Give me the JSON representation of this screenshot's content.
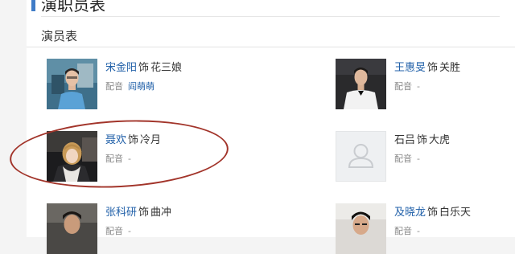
{
  "section": {
    "title": "演职员表"
  },
  "sub": {
    "title": "演员表"
  },
  "cast": [
    {
      "actor": "宋金阳",
      "shi": "饰",
      "role": "花三娘",
      "voice_label": "配音",
      "voice": "阎萌萌"
    },
    {
      "actor": "王惠旻",
      "shi": "饰",
      "role": "关胜",
      "voice_label": "配音",
      "voice": "-"
    },
    {
      "actor": "聂欢",
      "shi": "饰",
      "role": "冷月",
      "voice_label": "配音",
      "voice": "-"
    },
    {
      "actor": "石吕",
      "shi": "饰",
      "role": "大虎",
      "voice_label": "配音",
      "voice": "-"
    },
    {
      "actor": "张科研",
      "shi": "饰",
      "role": "曲冲",
      "voice_label": "配音",
      "voice": "-"
    },
    {
      "actor": "及晓龙",
      "shi": "饰",
      "role": "白乐天",
      "voice_label": "配音",
      "voice": "-"
    }
  ],
  "colors": {
    "accent": "#3f7cc7",
    "link": "#1f5fa8",
    "annotation": "#a2342a"
  },
  "icons": {
    "placeholder": "user-silhouette-icon"
  }
}
